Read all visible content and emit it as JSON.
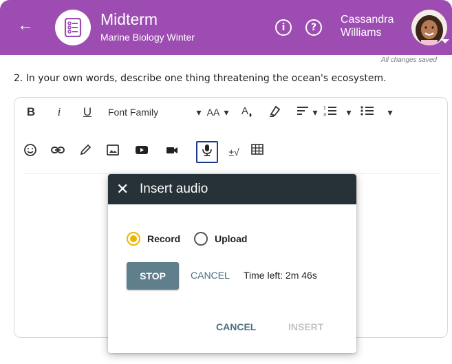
{
  "header": {
    "back_label": "←",
    "title": "Midterm",
    "subtitle": "Marine Biology Winter",
    "user_first": "Cassandra",
    "user_last": "Williams",
    "info_label": "i",
    "help_label": "?"
  },
  "status": {
    "saved_text": "All changes saved"
  },
  "question": {
    "text": "2. In your own words, describe one thing threatening the ocean's ecosystem."
  },
  "toolbar": {
    "bold": "B",
    "italic": "i",
    "underline": "U",
    "font_family": "Font Family",
    "font_size": "AA",
    "caret": "▾",
    "sqrt": "±√"
  },
  "dialog": {
    "close": "✕",
    "title": "Insert audio",
    "record_label": "Record",
    "upload_label": "Upload",
    "selected": "Record",
    "stop_label": "STOP",
    "cancel_recording_label": "CANCEL",
    "time_left": "Time left: 2m 46s",
    "cancel_label": "CANCEL",
    "insert_label": "INSERT"
  },
  "colors": {
    "brand": "#9d4db2",
    "dialog_header": "#263238",
    "stop_button": "#5f7f8d",
    "radio_selected": "#f0b400",
    "mic_highlight": "#1a3a8c"
  }
}
